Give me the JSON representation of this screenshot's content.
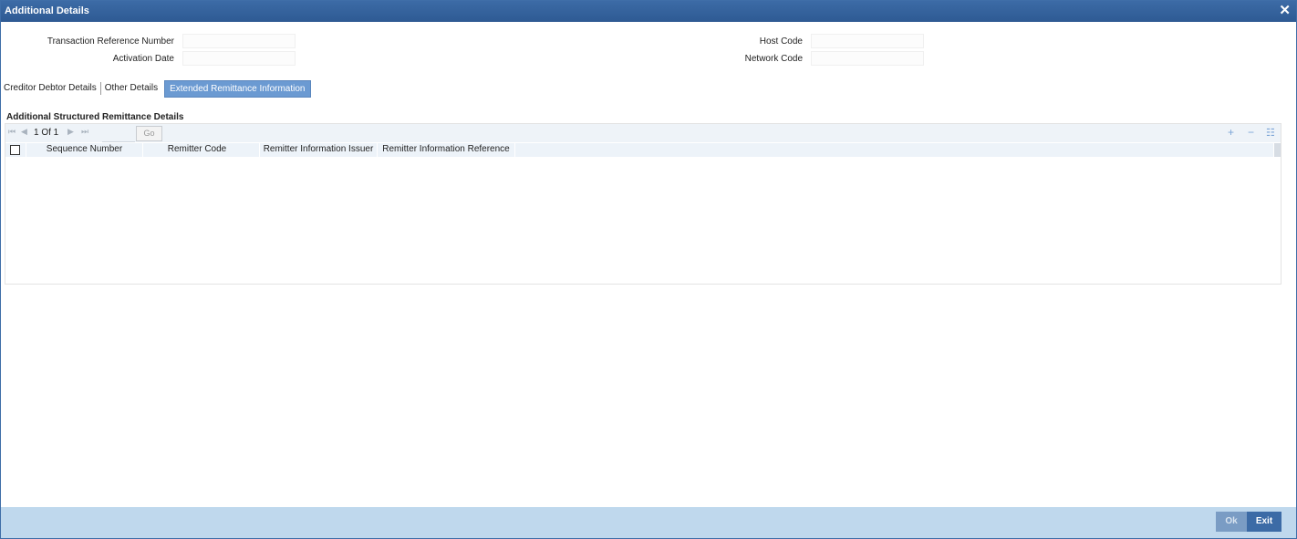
{
  "window": {
    "title": "Additional Details",
    "close_label": "✕"
  },
  "form": {
    "transaction_reference_number": {
      "label": "Transaction Reference Number",
      "value": ""
    },
    "activation_date": {
      "label": "Activation Date",
      "value": ""
    },
    "host_code": {
      "label": "Host Code",
      "value": ""
    },
    "network_code": {
      "label": "Network Code",
      "value": ""
    }
  },
  "tabs": [
    {
      "label": "Creditor Debtor Details",
      "active": false
    },
    {
      "label": "Other Details",
      "active": false
    },
    {
      "label": "Extended Remittance Information",
      "active": true
    }
  ],
  "section": {
    "title": "Additional Structured Remittance Details"
  },
  "grid": {
    "pager_text": "1 Of 1",
    "go_label": "Go",
    "columns": [
      "Sequence Number",
      "Remitter Code",
      "Remitter Information Issuer",
      "Remitter Information Reference"
    ],
    "rows": []
  },
  "footer": {
    "ok_label": "Ok",
    "exit_label": "Exit"
  },
  "colors": {
    "title_bar": "#2e5a93",
    "active_tab": "#6b9ad2",
    "footer": "#bfd8ed",
    "exit_button": "#3c6ba6"
  },
  "icons": [
    "close-icon",
    "first-page-icon",
    "prev-page-icon",
    "next-page-icon",
    "last-page-icon",
    "add-row-icon",
    "delete-row-icon",
    "single-view-icon"
  ]
}
